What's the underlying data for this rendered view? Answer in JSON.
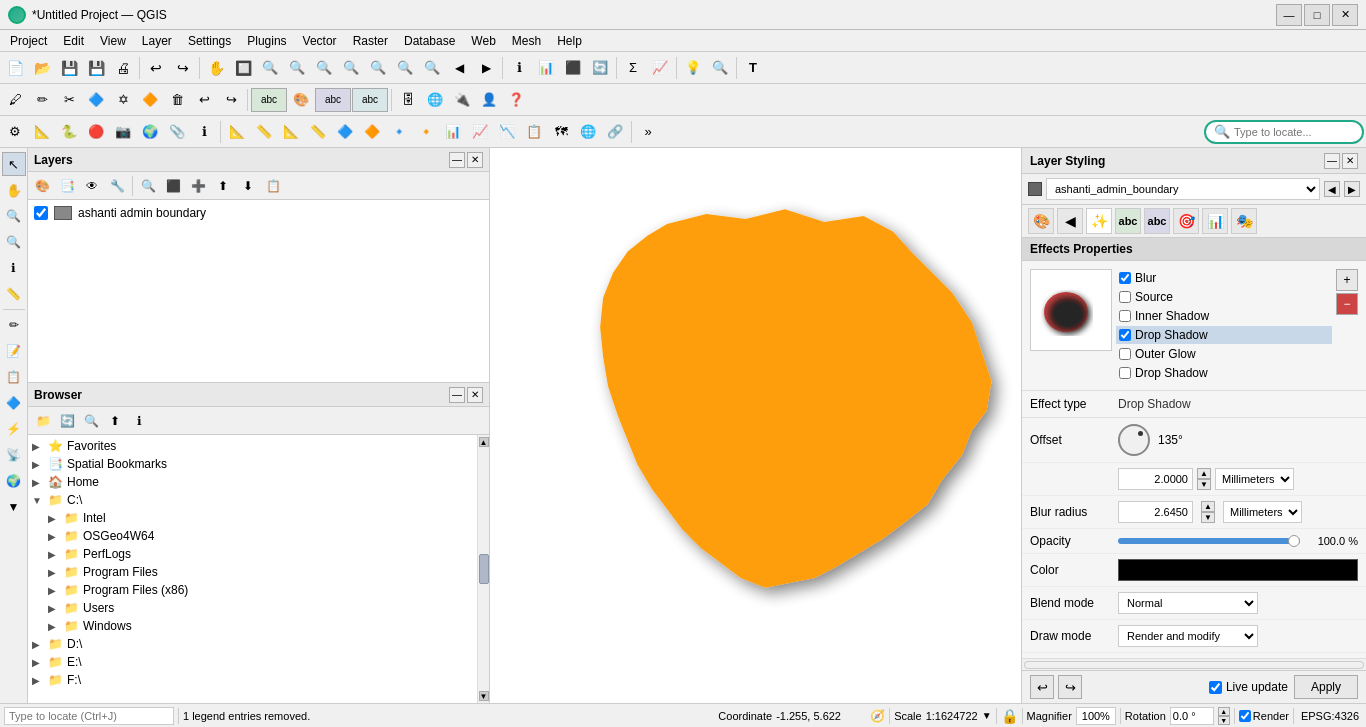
{
  "titlebar": {
    "title": "*Untitled Project — QGIS",
    "min": "—",
    "max": "□",
    "close": "✕"
  },
  "menubar": {
    "items": [
      "Project",
      "Edit",
      "View",
      "Layer",
      "Settings",
      "Plugins",
      "Vector",
      "Raster",
      "Database",
      "Web",
      "Mesh",
      "Help"
    ]
  },
  "toolbar1": {
    "buttons": [
      "📄",
      "📂",
      "💾",
      "💾",
      "🖨",
      "📋",
      "📋",
      "🔄",
      "⚙",
      "🗑",
      "✏",
      "🔍",
      "🔍",
      "🔍",
      "🔍",
      "🔍",
      "🔍",
      "🔲",
      "🔲",
      "🔲",
      "🔲",
      "📊",
      "🔄",
      "🔍",
      "📊",
      "📊",
      "📊",
      "📊",
      "📊",
      "T"
    ]
  },
  "layers_panel": {
    "title": "Layers",
    "layer_name": "ashanti admin boundary",
    "layer_checked": true
  },
  "browser_panel": {
    "title": "Browser",
    "items": [
      {
        "label": "Favorites",
        "icon": "⭐",
        "indent": 0,
        "toggle": "▶"
      },
      {
        "label": "Spatial Bookmarks",
        "icon": "📑",
        "indent": 0,
        "toggle": "▶"
      },
      {
        "label": "Home",
        "icon": "🏠",
        "indent": 0,
        "toggle": "▶"
      },
      {
        "label": "C:\\",
        "icon": "📁",
        "indent": 0,
        "toggle": "▼"
      },
      {
        "label": "Intel",
        "icon": "📁",
        "indent": 1,
        "toggle": "▶"
      },
      {
        "label": "OSGeo4W64",
        "icon": "📁",
        "indent": 1,
        "toggle": "▶"
      },
      {
        "label": "PerfLogs",
        "icon": "📁",
        "indent": 1,
        "toggle": "▶"
      },
      {
        "label": "Program Files",
        "icon": "📁",
        "indent": 1,
        "toggle": "▶"
      },
      {
        "label": "Program Files (x86)",
        "icon": "📁",
        "indent": 1,
        "toggle": "▶"
      },
      {
        "label": "Users",
        "icon": "📁",
        "indent": 1,
        "toggle": "▶"
      },
      {
        "label": "Windows",
        "icon": "📁",
        "indent": 1,
        "toggle": "▶"
      },
      {
        "label": "D:\\",
        "icon": "📁",
        "indent": 0,
        "toggle": "▶"
      },
      {
        "label": "E:\\",
        "icon": "📁",
        "indent": 0,
        "toggle": "▶"
      },
      {
        "label": "F:\\",
        "icon": "📁",
        "indent": 0,
        "toggle": "▶"
      }
    ]
  },
  "layer_styling": {
    "title": "Layer Styling",
    "layer_name": "ashanti_admin_boundary",
    "effects_title": "Effects Properties",
    "effects": [
      {
        "label": "Blur",
        "checked": true
      },
      {
        "label": "Source",
        "checked": false
      },
      {
        "label": "Inner Shadow",
        "checked": false
      },
      {
        "label": "Drop Shadow",
        "checked": true,
        "selected": true
      },
      {
        "label": "Outer Glow",
        "checked": false
      },
      {
        "label": "Drop Shadow",
        "checked": false
      }
    ],
    "effect_type_label": "Effect type",
    "effect_type_value": "Drop Shadow",
    "offset_label": "Offset",
    "offset_angle": "135°",
    "offset_value": "2.0000",
    "offset_unit": "Millimeters",
    "blur_radius_label": "Blur radius",
    "blur_radius_value": "2.6450",
    "blur_radius_unit": "Millimeters",
    "opacity_label": "Opacity",
    "opacity_value": "100.0 %",
    "opacity_percent": 100,
    "color_label": "Color",
    "blend_mode_label": "Blend mode",
    "blend_mode_value": "Normal",
    "draw_mode_label": "Draw mode",
    "draw_mode_value": "Render and modify",
    "live_update_label": "Live update",
    "apply_label": "Apply"
  },
  "statusbar": {
    "search_placeholder": "Type to locate (Ctrl+J)",
    "legend_msg": "1 legend entries removed.",
    "coordinate_label": "Coordinate",
    "coordinate_value": "-1.255, 5.622",
    "scale_label": "Scale",
    "scale_value": "1:1624722",
    "magnifier_label": "Magnifier",
    "magnifier_value": "100%",
    "rotation_label": "Rotation",
    "rotation_value": "0.0 °",
    "render_label": "Render",
    "epsg_label": "EPSG:4326"
  }
}
